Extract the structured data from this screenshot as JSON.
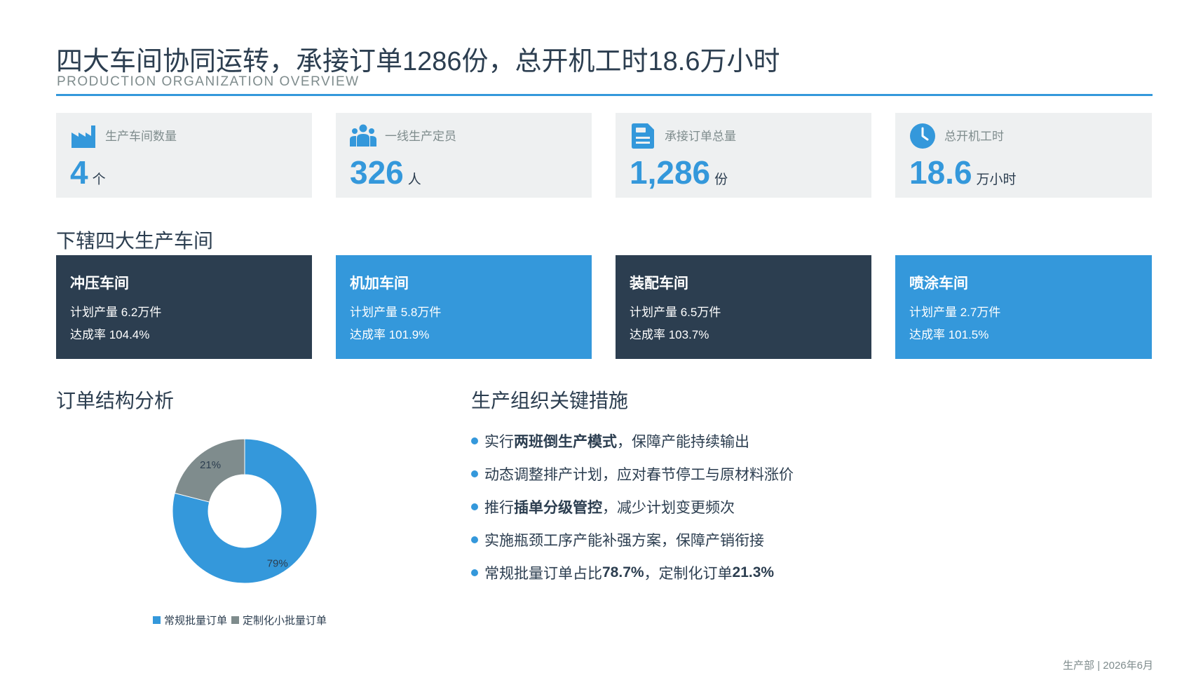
{
  "header": {
    "title": "四大车间协同运转，承接订单1286份，总开机工时18.6万小时",
    "subtitle": "PRODUCTION ORGANIZATION OVERVIEW"
  },
  "kpis": [
    {
      "icon": "factory-icon",
      "label": "生产车间数量",
      "value": "4",
      "unit": "个"
    },
    {
      "icon": "users-icon",
      "label": "一线生产定员",
      "value": "326",
      "unit": "人"
    },
    {
      "icon": "document-icon",
      "label": "承接订单总量",
      "value": "1,286",
      "unit": "份"
    },
    {
      "icon": "clock-icon",
      "label": "总开机工时",
      "value": "18.6",
      "unit": "万小时"
    }
  ],
  "workshops_section": {
    "title": "下辖四大生产车间"
  },
  "workshops": [
    {
      "name": "冲压车间",
      "plan": "计划产量 6.2万件",
      "rate": "达成率 104.4%",
      "color": "#2c3e50"
    },
    {
      "name": "机加车间",
      "plan": "计划产量 5.8万件",
      "rate": "达成率 101.9%",
      "color": "#3498db"
    },
    {
      "name": "装配车间",
      "plan": "计划产量 6.5万件",
      "rate": "达成率 103.7%",
      "color": "#2c3e50"
    },
    {
      "name": "喷涂车间",
      "plan": "计划产量 2.7万件",
      "rate": "达成率 101.5%",
      "color": "#3498db"
    }
  ],
  "order_section": {
    "title": "订单结构分析"
  },
  "chart_data": {
    "type": "pie",
    "donut": true,
    "categories": [
      "常规批量订单",
      "定制化小批量订单"
    ],
    "values": [
      79,
      21
    ],
    "labels": [
      "79%",
      "21%"
    ],
    "colors": [
      "#3498db",
      "#7f8c8d"
    ],
    "legend": "bottom"
  },
  "measures_section": {
    "title": "生产组织关键措施"
  },
  "measures": [
    {
      "pre": "实行",
      "bold": "两班倒生产模式",
      "post": "，保障产能持续输出"
    },
    {
      "pre": "动态调整排产计划，应对春节停工与原材料涨价",
      "bold": "",
      "post": ""
    },
    {
      "pre": "推行",
      "bold": "插单分级管控",
      "post": "，减少计划变更频次"
    },
    {
      "pre": "实施瓶颈工序产能补强方案，保障产销衔接",
      "bold": "",
      "post": ""
    },
    {
      "pre": "常规批量订单占比",
      "bold": "78.7%",
      "post": "，定制化订单",
      "bold2": "21.3%"
    }
  ],
  "footer": {
    "text": "生产部 | 2026年6月"
  },
  "colors": {
    "accent": "#3498db",
    "dark": "#2c3e50",
    "muted": "#7f8c8d",
    "card": "#eef0f1"
  }
}
